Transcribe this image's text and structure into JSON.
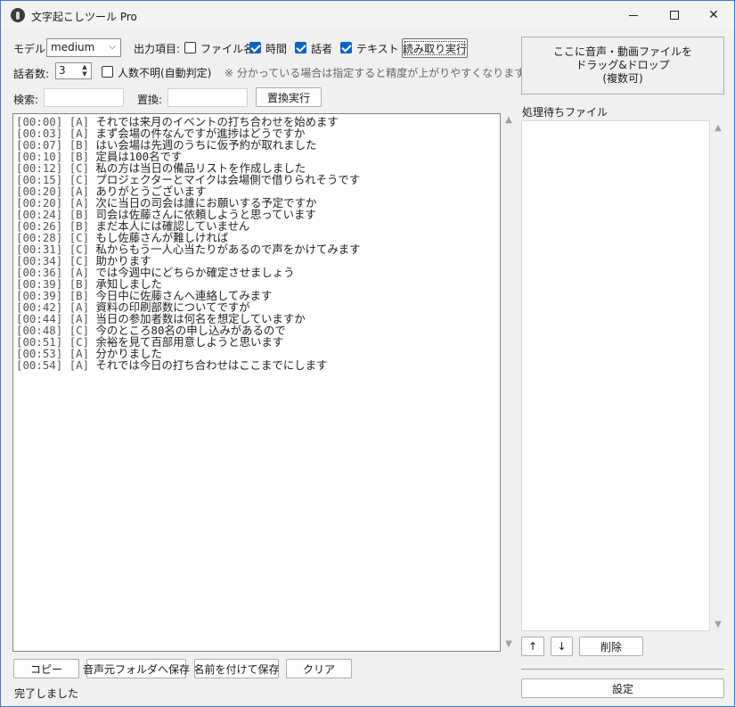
{
  "window": {
    "title": "文字起こしツール Pro"
  },
  "controls": {
    "model_label": "モデル:",
    "model_value": "medium",
    "output_label": "出力項目:",
    "output_options": [
      {
        "label": "ファイル名",
        "checked": false
      },
      {
        "label": "時間",
        "checked": true
      },
      {
        "label": "話者",
        "checked": true
      },
      {
        "label": "テキスト",
        "checked": true
      }
    ],
    "run_button": "読み取り実行",
    "speakers_label": "話者数:",
    "speakers_value": "3",
    "unknown_label": "人数不明(自動判定)",
    "unknown_checked": false,
    "hint": "※ 分かっている場合は指定すると精度が上がりやすくなります",
    "search_label": "検索:",
    "search_value": "",
    "replace_label": "置換:",
    "replace_value": "",
    "replace_button": "置換実行"
  },
  "transcript": [
    {
      "time": "[00:00]",
      "speaker": "[A]",
      "text": "それでは来月のイベントの打ち合わせを始めます"
    },
    {
      "time": "[00:03]",
      "speaker": "[A]",
      "text": "まず会場の件なんですが進捗はどうですか"
    },
    {
      "time": "[00:07]",
      "speaker": "[B]",
      "text": "はい会場は先週のうちに仮予約が取れました"
    },
    {
      "time": "[00:10]",
      "speaker": "[B]",
      "text": "定員は100名です"
    },
    {
      "time": "[00:12]",
      "speaker": "[C]",
      "text": "私の方は当日の備品リストを作成しました"
    },
    {
      "time": "[00:15]",
      "speaker": "[C]",
      "text": "プロジェクターとマイクは会場側で借りられそうです"
    },
    {
      "time": "[00:20]",
      "speaker": "[A]",
      "text": "ありがとうございます"
    },
    {
      "time": "[00:20]",
      "speaker": "[A]",
      "text": "次に当日の司会は誰にお願いする予定ですか"
    },
    {
      "time": "[00:24]",
      "speaker": "[B]",
      "text": "司会は佐藤さんに依頼しようと思っています"
    },
    {
      "time": "[00:26]",
      "speaker": "[B]",
      "text": "まだ本人には確認していません"
    },
    {
      "time": "[00:28]",
      "speaker": "[C]",
      "text": "もし佐藤さんが難しければ"
    },
    {
      "time": "[00:31]",
      "speaker": "[C]",
      "text": "私からもう一人心当たりがあるので声をかけてみます"
    },
    {
      "time": "[00:34]",
      "speaker": "[C]",
      "text": "助かります"
    },
    {
      "time": "[00:36]",
      "speaker": "[A]",
      "text": "では今週中にどちらか確定させましょう"
    },
    {
      "time": "[00:39]",
      "speaker": "[B]",
      "text": "承知しました"
    },
    {
      "time": "[00:39]",
      "speaker": "[B]",
      "text": "今日中に佐藤さんへ連絡してみます"
    },
    {
      "time": "[00:42]",
      "speaker": "[A]",
      "text": "資料の印刷部数についてですが"
    },
    {
      "time": "[00:44]",
      "speaker": "[A]",
      "text": "当日の参加者数は何名を想定していますか"
    },
    {
      "time": "[00:48]",
      "speaker": "[C]",
      "text": "今のところ80名の申し込みがあるので"
    },
    {
      "time": "[00:51]",
      "speaker": "[C]",
      "text": "余裕を見て百部用意しようと思います"
    },
    {
      "time": "[00:53]",
      "speaker": "[A]",
      "text": "分かりました"
    },
    {
      "time": "[00:54]",
      "speaker": "[A]",
      "text": "それでは今日の打ち合わせはここまでにします"
    }
  ],
  "bottom": {
    "copy_button": "コピー",
    "save_source_button": "音声元フォルダへ保存",
    "save_as_button": "名前を付けて保存",
    "clear_button": "クリア",
    "status": "完了しました"
  },
  "right": {
    "drop_lines": [
      "ここに音声・動画ファイルを",
      "ドラッグ&ドロップ",
      "(複数可)"
    ],
    "queue_label": "処理待ちファイル",
    "up_button": "↑",
    "down_button": "↓",
    "delete_button": "削除",
    "settings_button": "設定"
  },
  "colors": {
    "accent": "#0a64c8",
    "window_border": "#3a7bd5"
  }
}
